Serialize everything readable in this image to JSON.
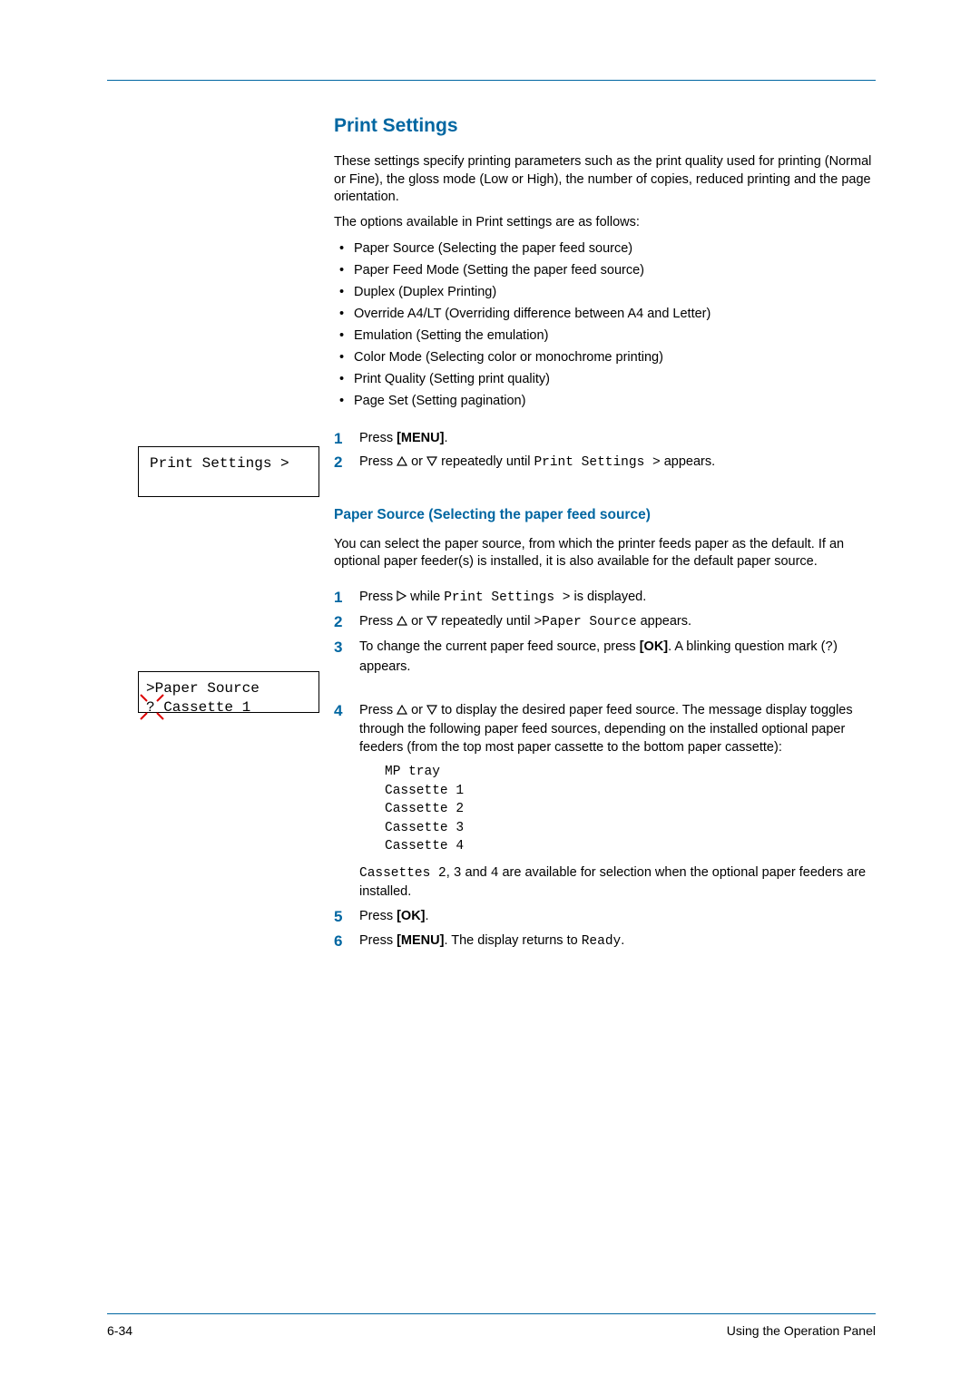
{
  "page": {
    "number_label": "6-34",
    "footer_right": "Using the Operation Panel"
  },
  "colors": {
    "accent": "#0066a1"
  },
  "section": {
    "title": "Print Settings",
    "intro1": "These settings specify printing parameters such as the print quality used for printing (Normal or Fine), the gloss mode (Low or High), the number of copies, reduced printing and the page orientation.",
    "intro2": "The options available in Print settings are as follows:",
    "options": [
      "Paper Source (Selecting the paper feed source)",
      "Paper Feed Mode (Setting the paper feed source)",
      "Duplex (Duplex Printing)",
      "Override A4/LT (Overriding difference between A4 and Letter)",
      "Emulation (Setting the emulation)",
      "Color Mode (Selecting color or monochrome printing)",
      "Print Quality (Setting print quality)",
      "Page Set (Setting pagination)"
    ],
    "steps_a": {
      "s1_pre": "Press ",
      "s1_bold": "[MENU]",
      "s1_post": ".",
      "s2_pre": "Press ",
      "s2_mid": " or ",
      "s2_post1": " repeatedly until ",
      "s2_mono": "Print Settings >",
      "s2_post2": " appears."
    }
  },
  "lcd": {
    "box1": "Print Settings >",
    "box2_line1": ">Paper Source",
    "box2_line2": "? Cassette 1"
  },
  "subsection": {
    "title": "Paper Source (Selecting the paper feed source)",
    "intro": "You can select the paper source, from which the printer feeds paper as the default. If an optional paper feeder(s) is installed, it is also available for the default paper source.",
    "steps": {
      "s1_pre": "Press ",
      "s1_mid": " while ",
      "s1_mono": "Print Settings >",
      "s1_post": " is displayed.",
      "s2_pre": "Press ",
      "s2_mid": " or ",
      "s2_post1": " repeatedly until ",
      "s2_mono": ">Paper Source",
      "s2_post2": " appears.",
      "s3_pre": "To change the current paper feed source, press ",
      "s3_bold": "[OK]",
      "s3_post1": ". A blinking question mark (",
      "s3_mono": "?",
      "s3_post2": ") appears.",
      "s4_pre": "Press ",
      "s4_mid": " or ",
      "s4_post": " to display the desired paper feed source. The message display toggles through the following paper feed sources, depending on the installed optional paper feeders (from the top most paper cassette to the bottom paper cassette):",
      "feed_block": "MP tray\nCassette 1\nCassette 2\nCassette 3\nCassette 4",
      "note_mono1": "Cassettes 2",
      "note_txt1": ", ",
      "note_mono2": "3",
      "note_txt2": " and ",
      "note_mono3": "4",
      "note_txt3": " are available for selection when the optional paper feeders are installed.",
      "s5_pre": "Press ",
      "s5_bold": "[OK]",
      "s5_post": ".",
      "s6_pre": "Press ",
      "s6_bold": "[MENU]",
      "s6_mid": ". The display returns to ",
      "s6_mono": "Ready",
      "s6_post": "."
    }
  }
}
